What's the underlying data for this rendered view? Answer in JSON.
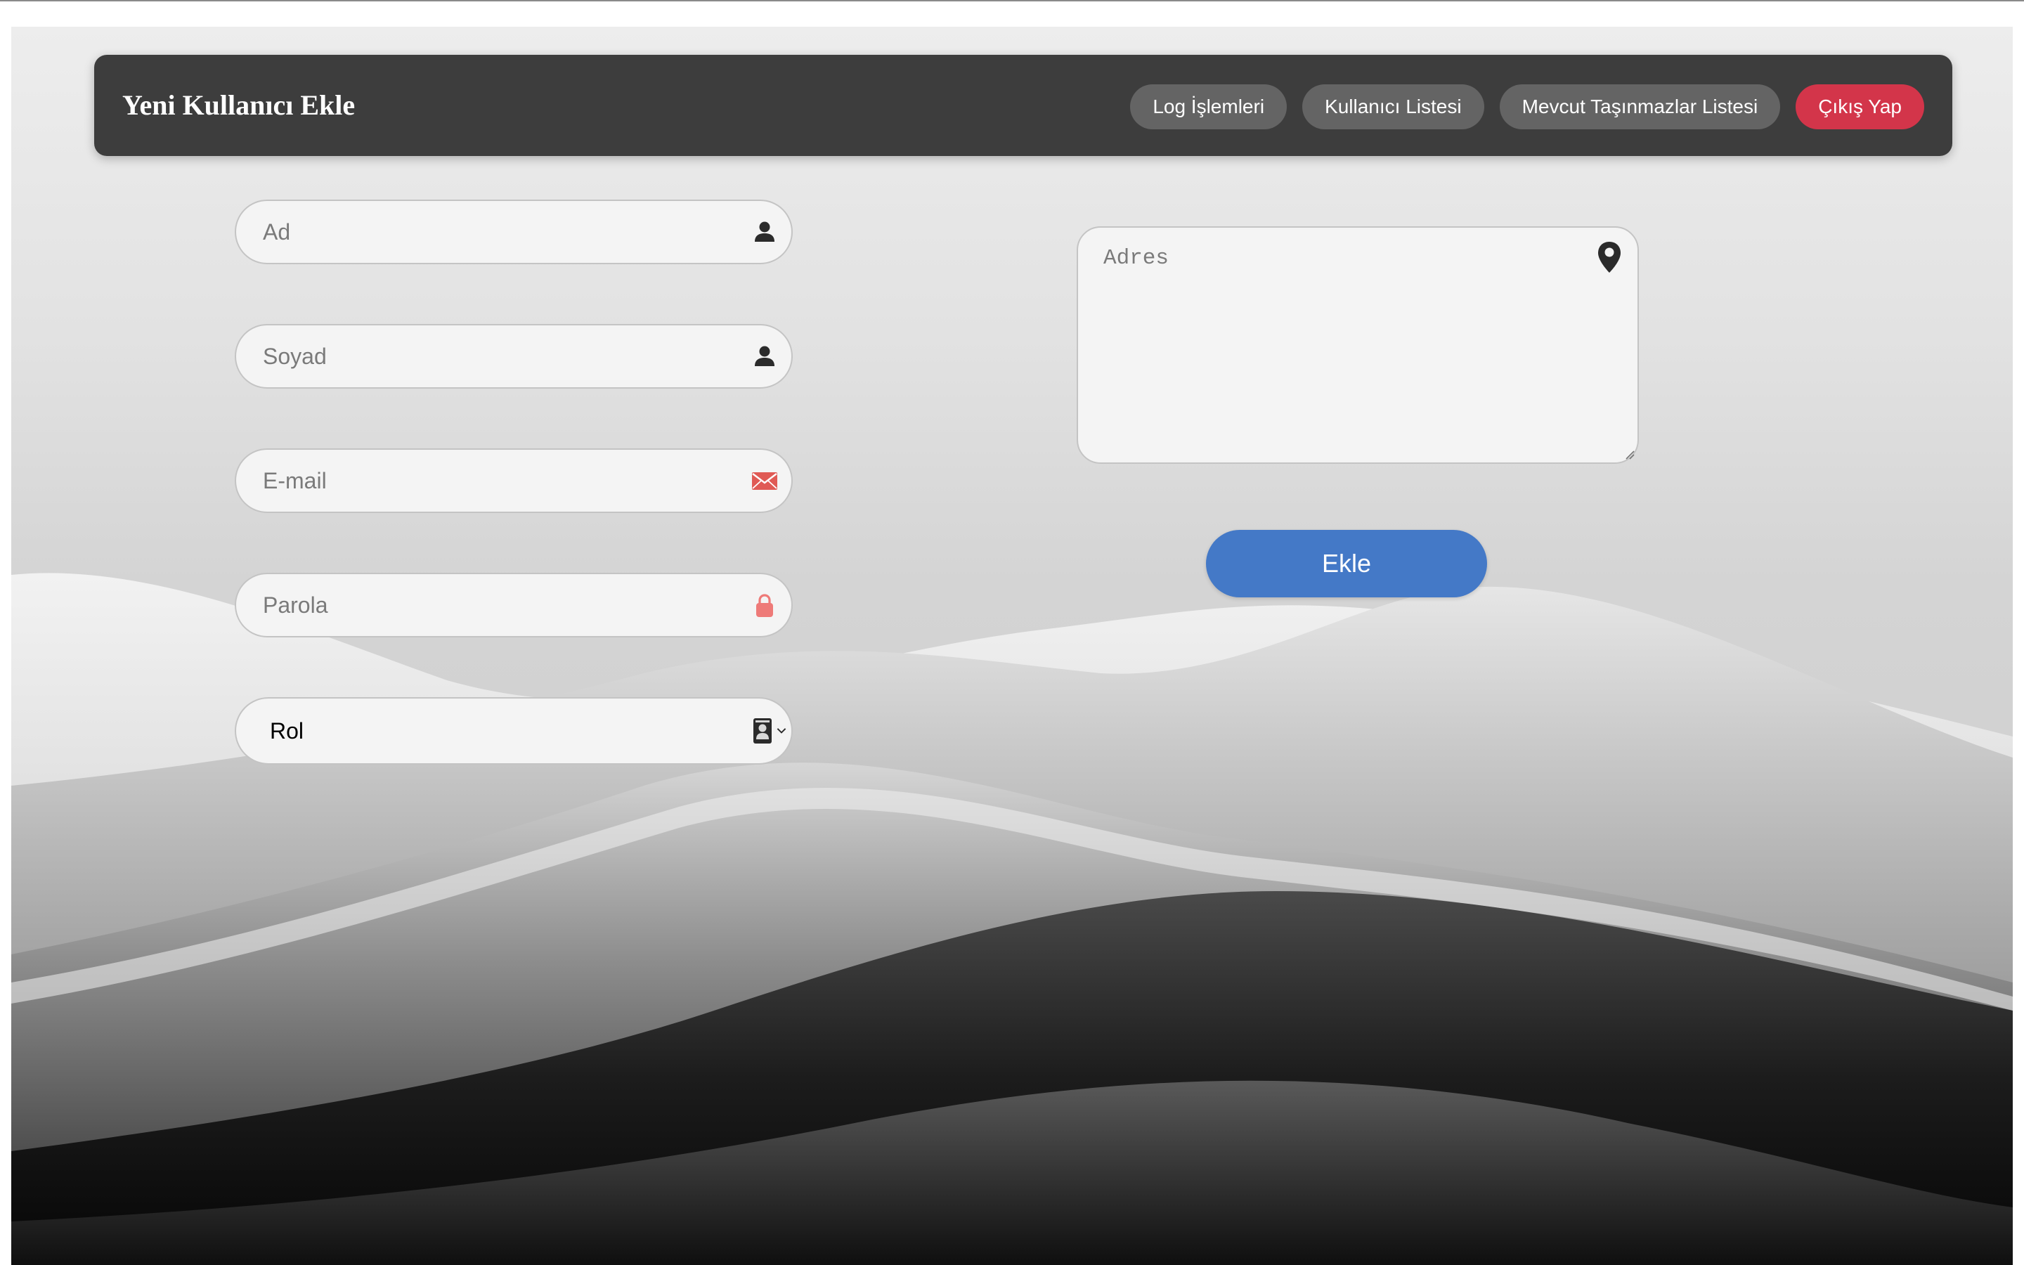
{
  "header": {
    "title": "Yeni Kullanıcı Ekle",
    "nav": {
      "log_label": "Log İşlemleri",
      "users_label": "Kullanıcı Listesi",
      "properties_label": "Mevcut Taşınmazlar Listesi",
      "logout_label": "Çıkış Yap"
    }
  },
  "form": {
    "first_name": {
      "placeholder": "Ad",
      "value": "",
      "icon": "user-icon"
    },
    "last_name": {
      "placeholder": "Soyad",
      "value": "",
      "icon": "user-icon"
    },
    "email": {
      "placeholder": "E-mail",
      "value": "",
      "icon": "envelope-icon"
    },
    "password": {
      "placeholder": "Parola",
      "value": "",
      "icon": "lock-icon"
    },
    "role": {
      "selected": "Rol",
      "icon": "id-badge-icon"
    },
    "address": {
      "placeholder": "Adres",
      "value": "",
      "icon": "map-pin-icon"
    },
    "submit_label": "Ekle"
  },
  "colors": {
    "navbar_bg": "#3d3d3d",
    "nav_button": "#646464",
    "logout_button": "#d3354a",
    "submit_button": "#4479c7",
    "envelope_icon": "#e05a55",
    "lock_icon": "#ee7a78"
  }
}
